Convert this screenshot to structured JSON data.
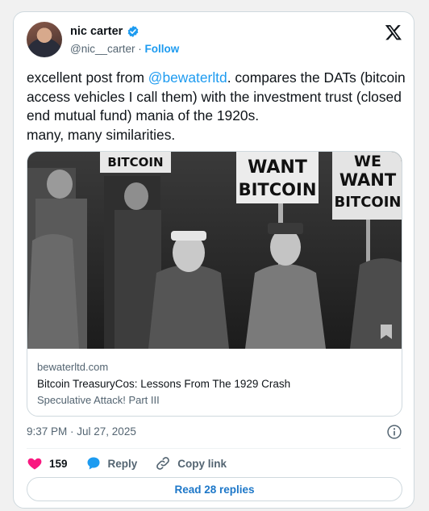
{
  "author": {
    "name": "nic carter",
    "handle": "@nic__carter",
    "separator": "·",
    "follow_label": "Follow"
  },
  "tweet": {
    "text_before": "excellent post from ",
    "mention": "@bewaterltd",
    "text_after": ". compares the DATs (bitcoin access vehicles I call them) with the investment trust (closed end mutual fund) mania of the 1920s.\nmany, many similarities.",
    "timestamp": "9:37 PM · Jul 27, 2025"
  },
  "link_card": {
    "domain": "bewaterltd.com",
    "title": "Bitcoin TreasuryCos: Lessons From The 1929 Crash",
    "description": "Speculative Attack! Part III",
    "image_signs": [
      "BITCOIN",
      "WANT",
      "BITCOIN",
      "WE",
      "WANT",
      "BITCOIN"
    ]
  },
  "actions": {
    "likes_count": "159",
    "reply_label": "Reply",
    "copy_link_label": "Copy link"
  },
  "read_replies_label": "Read 28 replies",
  "colors": {
    "accent": "#1d9bf0",
    "like": "#f91880",
    "text": "#0f1419",
    "muted": "#536471",
    "border": "#cfd9de"
  },
  "icons": [
    "verified-badge-icon",
    "x-logo-icon",
    "bookmark-icon",
    "info-icon",
    "heart-icon",
    "reply-bubble-icon",
    "link-icon"
  ]
}
